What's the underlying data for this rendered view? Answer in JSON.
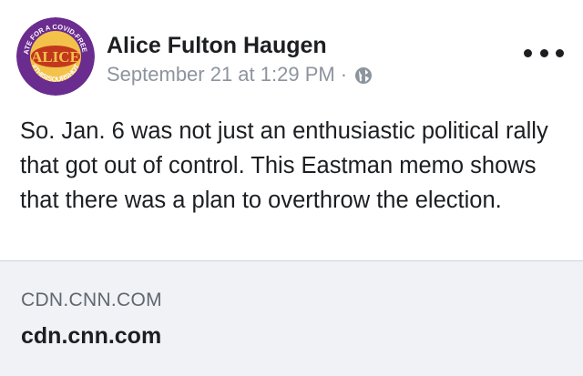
{
  "post": {
    "author": "Alice Fulton Haugen",
    "timestamp": "September 21 at 1:29 PM",
    "separator": "·",
    "privacy_icon": "globe-icon",
    "more_icon": "more-options-icon",
    "text": "So. Jan. 6 was not just an enthusiastic political rally that got out of control. This Eastman memo shows that there was a plan to overthrow the election.",
    "avatar": {
      "top_text": "VACCINATE FOR A COVID-FREE WORLD",
      "center_text": "ALICE",
      "bottom_text": "#THISISOURSHOT",
      "ring_color": "#6a2c8f",
      "center_color": "#c2381d"
    }
  },
  "link_preview": {
    "domain": "CDN.CNN.COM",
    "title": "cdn.cnn.com"
  }
}
